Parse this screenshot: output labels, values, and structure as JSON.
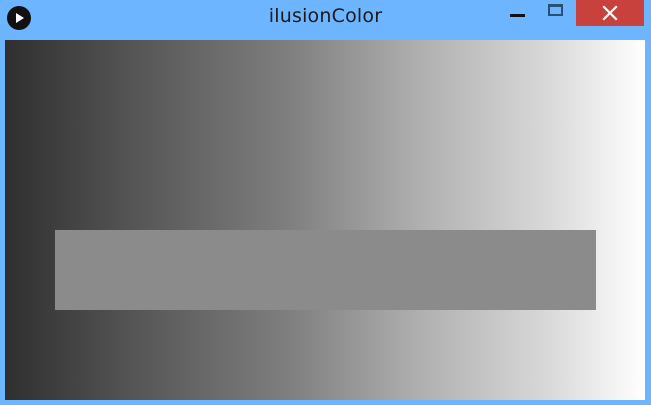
{
  "window": {
    "title": "ilusionColor"
  },
  "controls": {
    "minimize_icon": "minimize-icon",
    "maximize_icon": "maximize-icon",
    "close_icon": "close-icon"
  },
  "app_icon": "play-icon",
  "colors": {
    "titlebar": "#6db6ff",
    "close_button": "#c9413c",
    "gradient_start": "#2f2f2f",
    "gradient_end": "#ffffff",
    "bar": "#8b8b8b"
  }
}
